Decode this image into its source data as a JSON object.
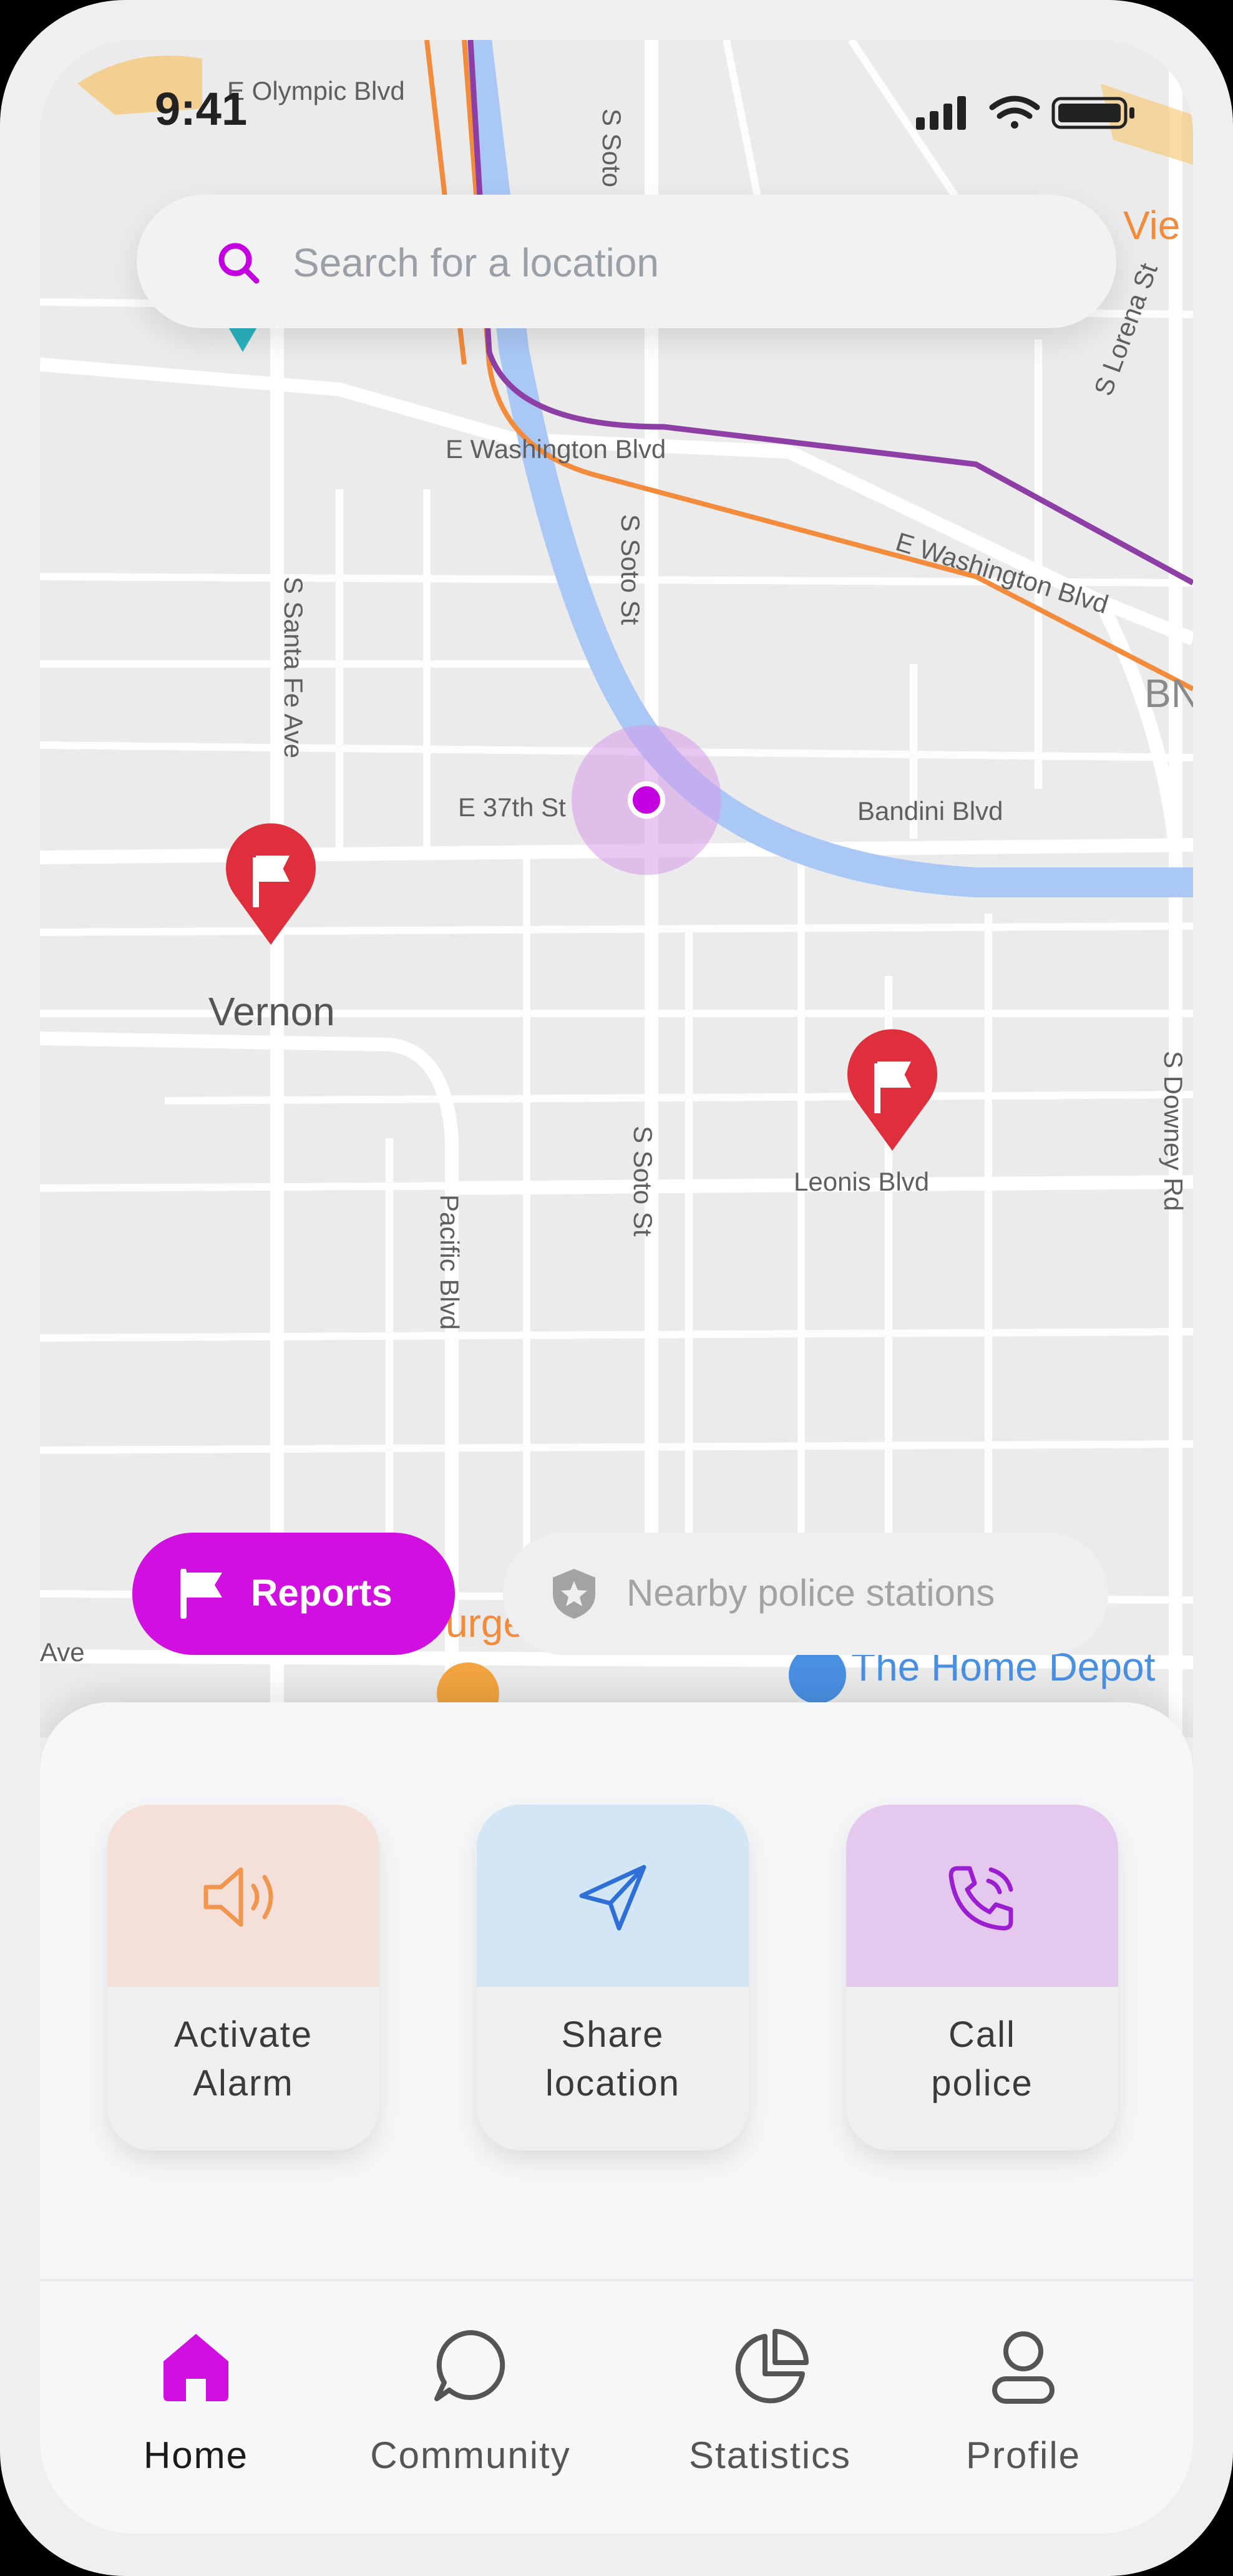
{
  "status_bar": {
    "time": "9:41"
  },
  "search": {
    "placeholder": "Search for a location"
  },
  "map": {
    "labels": {
      "olympic": "E Olympic Blvd",
      "soto_top": "S Soto St",
      "lorena": "S Lorena St",
      "washington1": "E Washington Blvd",
      "washington2": "E Washington Blvd",
      "soto_mid": "S Soto St",
      "santa_fe": "S Santa Fe Ave",
      "e37th": "E 37th St",
      "bandini": "Bandini Blvd",
      "vernon": "Vernon",
      "soto_low": "S Soto St",
      "leonis": "Leonis Blvd",
      "pacific": "Pacific Blvd",
      "downey": "S Downey Rd",
      "ave": "Ave",
      "view": "Vie",
      "bn": "BN",
      "burger": "urge",
      "home_depot": "The Home Depot"
    },
    "colors": {
      "route_purple": "#8e3fa6",
      "route_orange": "#f28b3c",
      "river": "#a9c8f5",
      "pin": "#e02f3c",
      "location": "#c400e0"
    }
  },
  "filters": {
    "reports": "Reports",
    "police": "Nearby police stations"
  },
  "actions": [
    {
      "label_line1": "Activate",
      "label_line2": "Alarm",
      "icon": "speaker-icon",
      "tile_color": "#f4e0d8"
    },
    {
      "label_line1": "Share",
      "label_line2": "location",
      "icon": "send-icon",
      "tile_color": "#d2e6f5"
    },
    {
      "label_line1": "Call",
      "label_line2": "police",
      "icon": "phone-icon",
      "tile_color": "#e4c8ee"
    }
  ],
  "nav": {
    "items": [
      {
        "label": "Home",
        "icon": "home-icon",
        "active": true
      },
      {
        "label": "Community",
        "icon": "chat-icon",
        "active": false
      },
      {
        "label": "Statistics",
        "icon": "pie-chart-icon",
        "active": false
      },
      {
        "label": "Profile",
        "icon": "user-icon",
        "active": false
      }
    ],
    "accent": "#d10fe0"
  }
}
